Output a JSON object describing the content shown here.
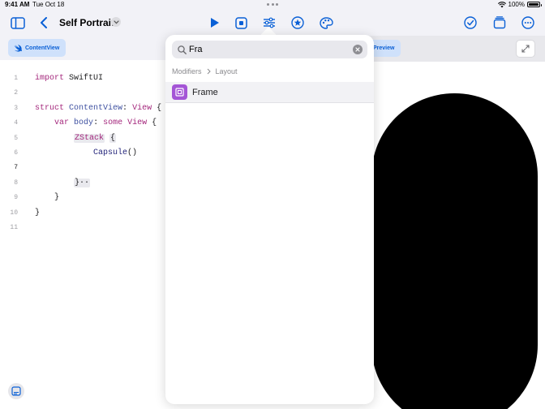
{
  "status_bar": {
    "time": "9:41 AM",
    "date": "Tue Oct 18",
    "battery": "100%",
    "battery_level": 1.0
  },
  "toolbar": {
    "title": "Self Portrait",
    "icons": [
      "sidebar-icon",
      "back-chevron-icon",
      "title-menu-chevron-icon",
      "play-icon",
      "stop-icon",
      "modifiers-sliders-icon",
      "star-icon",
      "palette-icon",
      "checkmark-circle-icon",
      "pages-icon",
      "more-icon"
    ]
  },
  "editor": {
    "file_chip": "ContentView",
    "current_line": 7,
    "lines": [
      {
        "n": "1",
        "tokens": [
          {
            "t": "import",
            "c": "kw"
          },
          {
            "t": " SwiftUI",
            "c": ""
          }
        ]
      },
      {
        "n": "2",
        "tokens": []
      },
      {
        "n": "3",
        "tokens": [
          {
            "t": "struct",
            "c": "kw"
          },
          {
            "t": " ",
            "c": ""
          },
          {
            "t": "ContentView",
            "c": "ty"
          },
          {
            "t": ": ",
            "c": ""
          },
          {
            "t": "View",
            "c": "kw"
          },
          {
            "t": " {",
            "c": ""
          }
        ]
      },
      {
        "n": "4",
        "tokens": [
          {
            "t": "    ",
            "c": ""
          },
          {
            "t": "var",
            "c": "kw"
          },
          {
            "t": " ",
            "c": ""
          },
          {
            "t": "body",
            "c": "ty"
          },
          {
            "t": ": ",
            "c": ""
          },
          {
            "t": "some",
            "c": "kw"
          },
          {
            "t": " ",
            "c": ""
          },
          {
            "t": "View",
            "c": "kw"
          },
          {
            "t": " {",
            "c": ""
          }
        ]
      },
      {
        "n": "5",
        "tokens": [
          {
            "t": "        ",
            "c": ""
          },
          {
            "t": "ZStack",
            "c": "kw hl"
          },
          {
            "t": " ",
            "c": ""
          },
          {
            "t": "{",
            "c": "hl"
          }
        ]
      },
      {
        "n": "6",
        "tokens": [
          {
            "t": "            ",
            "c": ""
          },
          {
            "t": "Capsule",
            "c": "fn"
          },
          {
            "t": "()",
            "c": ""
          }
        ]
      },
      {
        "n": "7",
        "tokens": []
      },
      {
        "n": "8",
        "tokens": [
          {
            "t": "        ",
            "c": ""
          },
          {
            "t": "}··",
            "c": "hl"
          }
        ]
      },
      {
        "n": "9",
        "tokens": [
          {
            "t": "    }",
            "c": ""
          }
        ]
      },
      {
        "n": "10",
        "tokens": [
          {
            "t": "}",
            "c": ""
          }
        ]
      },
      {
        "n": "11",
        "tokens": []
      }
    ]
  },
  "preview": {
    "button_label": "Preview"
  },
  "popover": {
    "search_value": "Fra",
    "breadcrumb": [
      "Modifiers",
      "Layout"
    ],
    "results": [
      {
        "label": "Frame",
        "icon": "frame-icon"
      }
    ]
  },
  "colors": {
    "accent": "#0a60d6",
    "chip_bg": "#cfe1fb",
    "frame_icon": "#a455d6",
    "keyword": "#a4277c"
  }
}
